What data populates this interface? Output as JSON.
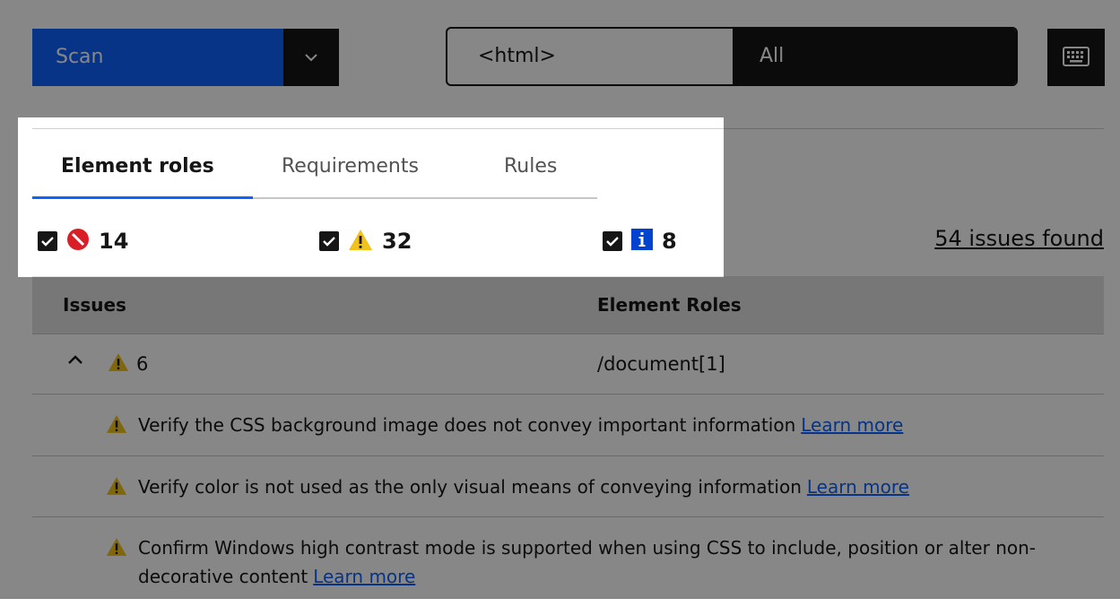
{
  "toolbar": {
    "scan_label": "Scan",
    "scope_element": "<html>",
    "scope_filter": "All"
  },
  "tabs": [
    {
      "label": "Element roles",
      "active": true
    },
    {
      "label": "Requirements",
      "active": false
    },
    {
      "label": "Rules",
      "active": false
    }
  ],
  "filters": {
    "violations_count": "14",
    "needs_review_count": "32",
    "recommendations_count": "8",
    "issues_found": "54 issues found"
  },
  "table": {
    "headers": {
      "issues": "Issues",
      "element_roles": "Element Roles"
    },
    "group": {
      "count": "6",
      "role": "/document[1]"
    },
    "issues": [
      {
        "text": "Verify the CSS background image does not convey important information",
        "link": "Learn more"
      },
      {
        "text": "Verify color is not used as the only visual means of conveying information",
        "link": "Learn more"
      },
      {
        "text": "Confirm Windows high contrast mode is supported when using CSS to include, position or alter non-decorative content",
        "link": "Learn more"
      }
    ]
  },
  "colors": {
    "primary": "#0f62fe",
    "violation": "#da1e28",
    "needs_review": "#f1c21b",
    "recommendation": "#0043ce",
    "overlay": "rgba(0,0,0,0.47)"
  },
  "icons": [
    "chevron-down-icon",
    "keyboard-icon",
    "checkbox-checked-icon",
    "violation-icon",
    "warning-icon",
    "info-icon",
    "chevron-up-icon"
  ]
}
